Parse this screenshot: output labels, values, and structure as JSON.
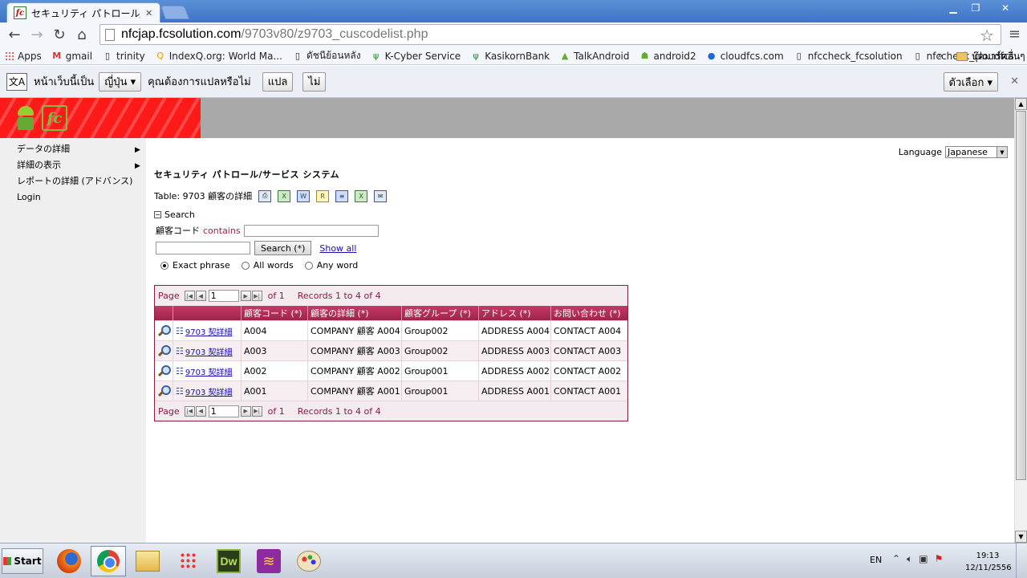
{
  "browser": {
    "tab_title": "セキュリティ パトロール/サ",
    "tab_favicon_text": "fc",
    "url_host": "nfcjap.fcsolution.com",
    "url_path": "/9703v80/z9703_cuscodelist.php",
    "window_buttons": {
      "minimize": "▁",
      "maximize": "❐",
      "close": "✕"
    },
    "nav": {
      "back": "←",
      "forward": "→",
      "reload": "↻",
      "home": "⌂"
    }
  },
  "bookmarks": {
    "items": [
      {
        "label": "Apps",
        "icon": "apps-grid-icon"
      },
      {
        "label": "gmail",
        "icon": "gmail-icon",
        "glyph": "M"
      },
      {
        "label": "trinity",
        "icon": "page-icon",
        "glyph": "▯"
      },
      {
        "label": "IndexQ.org: World Ma...",
        "icon": "indexq-icon",
        "glyph": "Q"
      },
      {
        "label": "ดัชนีย้อนหลัง",
        "icon": "page-icon",
        "glyph": "▯"
      },
      {
        "label": "K-Cyber Service",
        "icon": "kbank-icon",
        "glyph": "ψ"
      },
      {
        "label": "KasikornBank",
        "icon": "kbank-icon",
        "glyph": "ψ"
      },
      {
        "label": "TalkAndroid",
        "icon": "android-icon",
        "glyph": "▲"
      },
      {
        "label": "android2",
        "icon": "android-icon",
        "glyph": "☗"
      },
      {
        "label": "cloudfcs.com",
        "icon": "globe-icon",
        "glyph": "●"
      },
      {
        "label": "nfccheck_fcsolution",
        "icon": "page-icon",
        "glyph": "▯"
      },
      {
        "label": "nfccheck_cloudfcs",
        "icon": "page-icon",
        "glyph": "▯"
      }
    ],
    "more": "»",
    "other_label": "บุ๊คมาร์คอื่นๆ"
  },
  "translate_bar": {
    "icon_glyph": "文A",
    "prefix": "หน้าเว็บนี้เป็น",
    "language": "ญี่ปุ่น ▾",
    "question": "คุณต้องการแปลหรือไม่",
    "translate_btn": "แปล",
    "no_btn": "ไม่",
    "options_btn": "ตัวเลือก ▾",
    "close": "✕"
  },
  "sidebar": {
    "items": [
      {
        "label": "データの詳細",
        "arrow": "▶"
      },
      {
        "label": "詳細の表示",
        "arrow": "▶"
      },
      {
        "label": "レポートの詳細 (アドバンス)",
        "arrow": ""
      },
      {
        "label": "Login",
        "arrow": ""
      }
    ]
  },
  "page": {
    "language_label": "Language",
    "language_value": "Japanese",
    "system_title": "セキュリティ パトロール/サービス システム",
    "table_title": "Table: 9703 顧客の詳細",
    "tool_icons": [
      {
        "name": "print-icon",
        "glyph": "⎙"
      },
      {
        "name": "excel-icon",
        "glyph": "X"
      },
      {
        "name": "word-icon",
        "glyph": "W"
      },
      {
        "name": "rtf-icon",
        "glyph": "R"
      },
      {
        "name": "xml-icon",
        "glyph": "≡"
      },
      {
        "name": "csv-icon",
        "glyph": "X"
      },
      {
        "name": "email-icon",
        "glyph": "✉"
      }
    ]
  },
  "search": {
    "toggle_icon": "−",
    "toggle_label": "Search",
    "field_label": "顧客コード",
    "operator": "contains",
    "field_value": "",
    "field2_value": "",
    "button": "Search (*)",
    "show_all": "Show all",
    "modes": [
      {
        "label": "Exact phrase",
        "checked": true
      },
      {
        "label": "All words",
        "checked": false
      },
      {
        "label": "Any word",
        "checked": false
      }
    ]
  },
  "grid": {
    "pager": {
      "page_label": "Page",
      "page_value": "1",
      "of_label": "of 1",
      "records": "Records 1 to 4 of 4",
      "first": "|◀",
      "prev": "◀",
      "next": "▶",
      "last": "▶|"
    },
    "headers": [
      "",
      "",
      "顧客コード (*)",
      "顧客の詳細 (*)",
      "顧客グループ (*)",
      "アドレス (*)",
      "お問い合わせ (*)"
    ],
    "detail_link": "9703 契詳細",
    "rows": [
      {
        "code": "A004",
        "detail": "COMPANY 顧客 A004",
        "group": "Group002",
        "address": "ADDRESS A004",
        "contact": "CONTACT A004"
      },
      {
        "code": "A003",
        "detail": "COMPANY 顧客 A003",
        "group": "Group002",
        "address": "ADDRESS A003",
        "contact": "CONTACT A003"
      },
      {
        "code": "A002",
        "detail": "COMPANY 顧客 A002",
        "group": "Group001",
        "address": "ADDRESS A002",
        "contact": "CONTACT A002"
      },
      {
        "code": "A001",
        "detail": "COMPANY 顧客 A001",
        "group": "Group001",
        "address": "ADDRESS A001",
        "contact": "CONTACT A001"
      }
    ]
  },
  "taskbar": {
    "start": "Start",
    "apps": [
      {
        "name": "firefox-icon"
      },
      {
        "name": "chrome-icon"
      },
      {
        "name": "explorer-icon"
      },
      {
        "name": "apps-grid-icon"
      },
      {
        "name": "dreamweaver-icon",
        "glyph": "Dw"
      },
      {
        "name": "book-icon",
        "glyph": "≋"
      },
      {
        "name": "paint-icon"
      }
    ],
    "lang": "EN",
    "time": "19:13",
    "date": "12/11/2556"
  }
}
